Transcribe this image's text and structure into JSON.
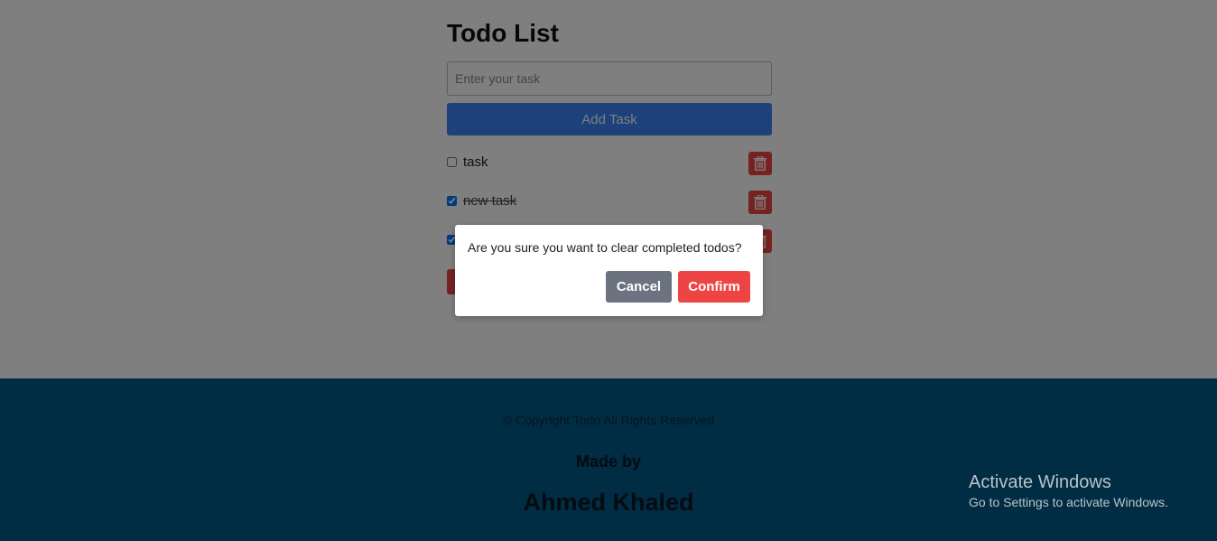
{
  "app": {
    "title": "Todo List",
    "input": {
      "placeholder": "Enter your task",
      "value": ""
    },
    "add_button_label": "Add Task",
    "todos": [
      {
        "text": "task",
        "completed": false
      },
      {
        "text": "new task",
        "completed": true
      },
      {
        "text": "",
        "completed": true
      }
    ]
  },
  "footer": {
    "copyright": "© Copyright Todo All Rights Reserved",
    "made_by": "Made by",
    "author": "Ahmed Khaled"
  },
  "dialog": {
    "message": "Are you sure you want to clear completed todos?",
    "cancel_label": "Cancel",
    "confirm_label": "Confirm"
  },
  "watermark": {
    "title": "Activate Windows",
    "subtitle": "Go to Settings to activate Windows."
  },
  "colors": {
    "primary": "#3b82f6",
    "danger": "#ef4444",
    "cancel": "#6b7280",
    "footer": "#005a88"
  },
  "icons": {
    "delete": "trash-icon"
  }
}
